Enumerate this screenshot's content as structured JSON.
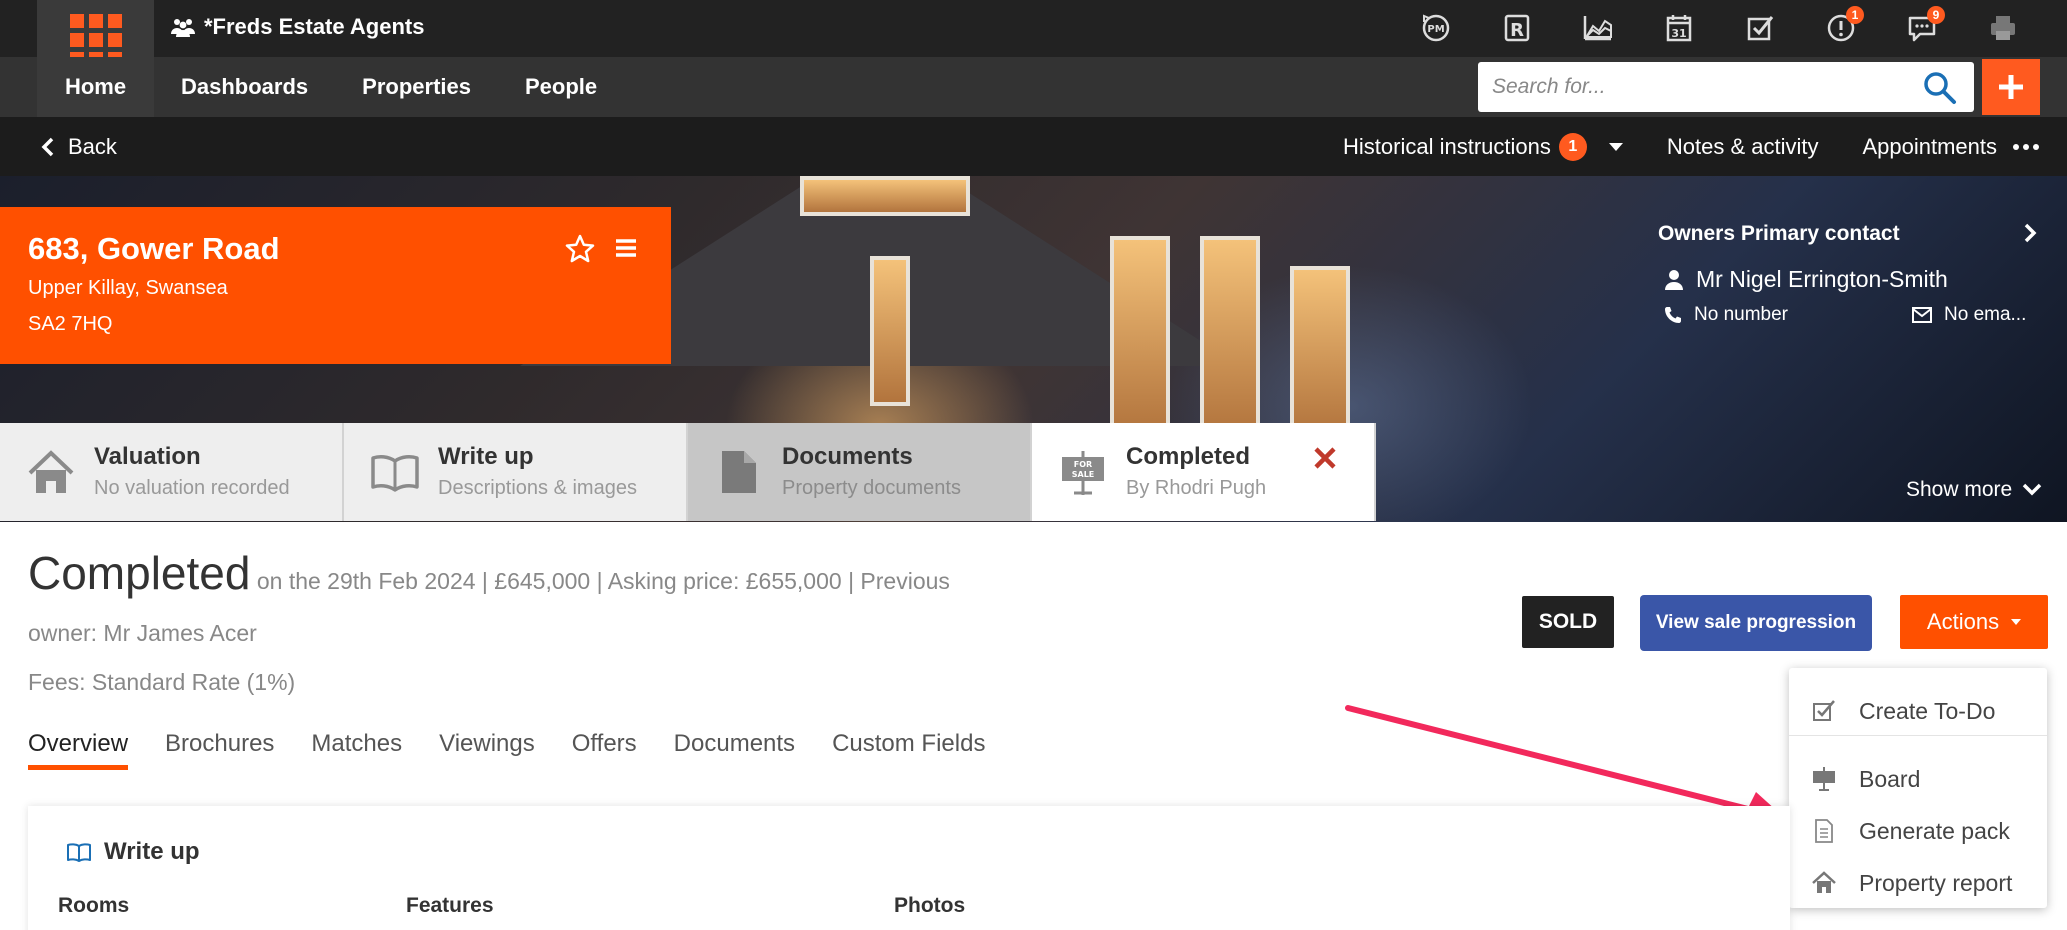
{
  "app": {
    "agency_name": "*Freds Estate Agents",
    "accent_color": "#ff5000"
  },
  "top_icons": [
    {
      "name": "pm-sync-icon",
      "badge": ""
    },
    {
      "name": "r-icon",
      "badge": ""
    },
    {
      "name": "chart-icon",
      "badge": ""
    },
    {
      "name": "calendar-icon",
      "badge": ""
    },
    {
      "name": "checkbox-icon",
      "badge": ""
    },
    {
      "name": "alert-icon",
      "badge": "1"
    },
    {
      "name": "chat-icon",
      "badge": "9"
    },
    {
      "name": "printer-icon",
      "badge": ""
    }
  ],
  "nav": {
    "items": [
      "Home",
      "Dashboards",
      "Properties",
      "People"
    ],
    "active": "Home"
  },
  "search": {
    "placeholder": "Search for..."
  },
  "subbar": {
    "back_label": "Back",
    "historical_label": "Historical instructions",
    "historical_count": "1",
    "notes_label": "Notes & activity",
    "appointments_label": "Appointments"
  },
  "property": {
    "address_line1": "683, Gower Road",
    "address_line2": "Upper Killay, Swansea",
    "postcode": "SA2 7HQ"
  },
  "owner": {
    "title": "Owners Primary contact",
    "name": "Mr Nigel Errington-Smith",
    "phone": "No number",
    "email": "No ema..."
  },
  "show_more_label": "Show more",
  "stages": [
    {
      "title": "Valuation",
      "subtitle": "No valuation recorded"
    },
    {
      "title": "Write up",
      "subtitle": "Descriptions & images"
    },
    {
      "title": "Documents",
      "subtitle": "Property documents"
    },
    {
      "title": "Completed",
      "subtitle": "By Rhodri Pugh"
    }
  ],
  "status": {
    "title": "Completed",
    "detail": "on the 29th Feb 2024  | £645,000 | Asking price: £655,000  | Previous",
    "owner_line": "owner: Mr James Acer",
    "fees_line": "Fees: Standard Rate (1%)"
  },
  "buttons": {
    "sold": "SOLD",
    "view_sale": "View sale progression",
    "actions": "Actions"
  },
  "actions_menu": [
    {
      "label": "Create To-Do",
      "icon": "checkbox-icon"
    },
    {
      "label": "Board",
      "icon": "for-sale-board-icon"
    },
    {
      "label": "Generate pack",
      "icon": "document-icon"
    },
    {
      "label": "Property report",
      "icon": "house-icon"
    }
  ],
  "tabs": [
    "Overview",
    "Brochures",
    "Matches",
    "Viewings",
    "Offers",
    "Documents",
    "Custom Fields"
  ],
  "writeup_card": {
    "title": "Write up",
    "columns": [
      "Rooms",
      "Features",
      "Photos"
    ]
  }
}
